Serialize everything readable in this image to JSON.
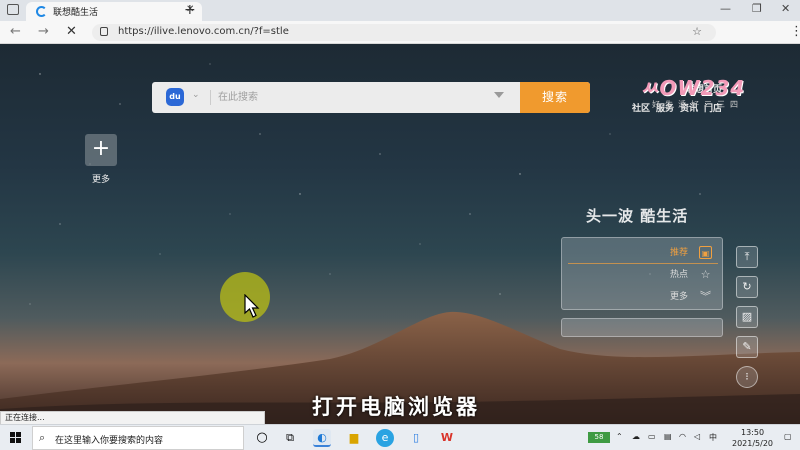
{
  "browser": {
    "tab_title": "联想酷生活",
    "url": "https://ilive.lenovo.com.cn/?f=stle",
    "status_text": "正在连接..."
  },
  "page": {
    "search_placeholder": "在此搜索",
    "search_button": "搜索",
    "engine_label": "du",
    "top_links": {
      "home": "联想首页",
      "items": [
        "社区",
        "服务",
        "资讯",
        "门店"
      ]
    },
    "shortcut_label": "更多",
    "slogan": "头一波 酷生活",
    "panel_rows": [
      "推荐",
      "热点",
      "更多"
    ],
    "subtitle": "打开电脑浏览器"
  },
  "watermark": {
    "logo": "ㅆOW234",
    "tagline": "好生活好二三四"
  },
  "taskbar": {
    "search_text": "在这里输入你要搜索的内容",
    "battery": "58",
    "ime": "中",
    "time": "13:50",
    "date": "2021/5/20"
  },
  "colors": {
    "accent": "#f09a2e",
    "baidu_blue": "#2b68d6",
    "cursor_halo": "#b9be14"
  }
}
